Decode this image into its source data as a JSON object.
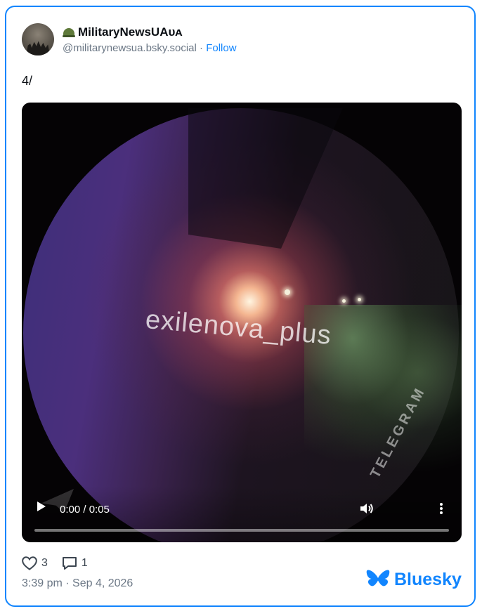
{
  "post": {
    "author": {
      "display_name": "MilitaryNewsUAᴜᴀ",
      "handle": "@militarynewsua.bsky.social",
      "separator": " · ",
      "follow_label": "Follow",
      "name_emoji_icon": "military-helmet-icon",
      "avatar_icon": "soldiers-silhouette-avatar"
    },
    "text": "4/",
    "video": {
      "watermark_text": "exilenova_plus",
      "telegram_watermark": "TELEGRAM",
      "time_display": "0:00 / 0:05",
      "progress_fraction": 0.0,
      "play_icon": "play-icon",
      "volume_icon": "volume-icon",
      "menu_icon": "more-vertical-icon"
    },
    "stats": {
      "likes": "3",
      "replies": "1"
    },
    "timestamp": "3:39 pm · Sep 4, 2026"
  },
  "brand": {
    "name": "Bluesky",
    "icon": "butterfly-icon"
  },
  "colors": {
    "accent": "#1185fe",
    "text_primary": "#0b0f14",
    "text_secondary": "#6b7785"
  }
}
